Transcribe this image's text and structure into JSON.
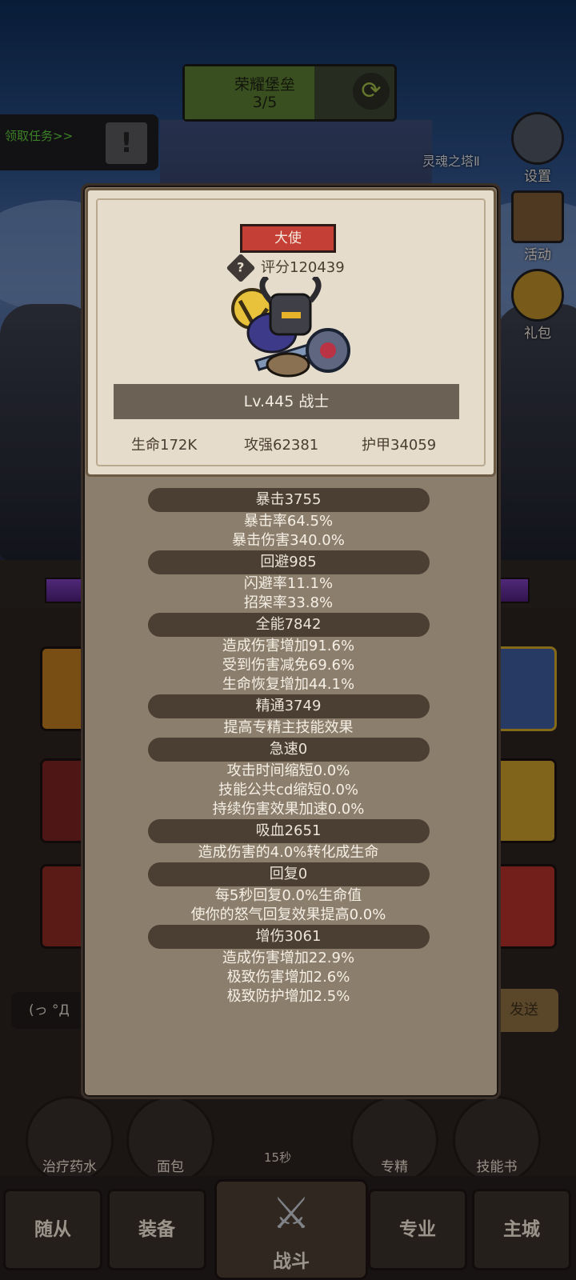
{
  "hud": {
    "quest_name": "荣耀堡垒",
    "quest_progress": "3/5",
    "task_link": "领取任务>>",
    "tower_label": "灵魂之塔Ⅱ",
    "side_buttons": [
      "设置",
      "活动",
      "礼包"
    ]
  },
  "popup": {
    "title": "大使",
    "score_label": "评分120439",
    "level_class": "Lv.445 战士",
    "base_stats": [
      "生命172K",
      "攻强62381",
      "护甲34059"
    ],
    "groups": [
      {
        "head": "暴击3755",
        "subs": [
          "暴击率64.5%",
          "暴击伤害340.0%"
        ]
      },
      {
        "head": "回避985",
        "subs": [
          "闪避率11.1%",
          "招架率33.8%"
        ]
      },
      {
        "head": "全能7842",
        "subs": [
          "造成伤害增加91.6%",
          "受到伤害减免69.6%",
          "生命恢复增加44.1%"
        ]
      },
      {
        "head": "精通3749",
        "subs": [
          "提高专精主技能效果"
        ]
      },
      {
        "head": "急速0",
        "subs": [
          "攻击时间缩短0.0%",
          "技能公共cd缩短0.0%",
          "持续伤害效果加速0.0%"
        ]
      },
      {
        "head": "吸血2651",
        "subs": [
          "造成伤害的4.0%转化成生命"
        ]
      },
      {
        "head": "回复0",
        "subs": [
          "每5秒回复0.0%生命值",
          "使你的怒气回复效果提高0.0%"
        ]
      },
      {
        "head": "增伤3061",
        "subs": [
          "造成伤害增加22.9%",
          "极致伤害增加2.6%",
          "极致防护增加2.5%"
        ]
      }
    ]
  },
  "chat_input": "(っ °Д",
  "send_label": "发送",
  "items": [
    "治疗药水",
    "面包",
    "专精",
    "技能书"
  ],
  "item_timer": "15秒",
  "nav": [
    "随从",
    "装备",
    "战斗",
    "专业",
    "主城"
  ]
}
